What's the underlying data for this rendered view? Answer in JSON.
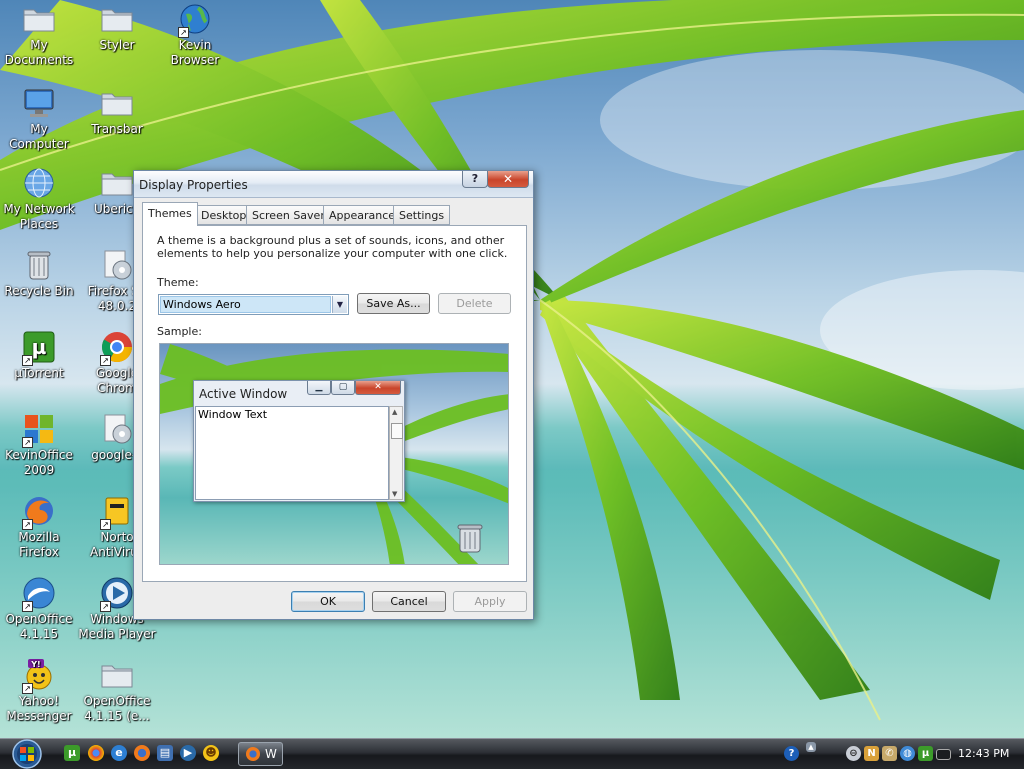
{
  "desktop_icons": [
    {
      "id": "my-documents",
      "label": "My\nDocuments",
      "icon": "folder-icon",
      "shortcut": false
    },
    {
      "id": "styler",
      "label": "Styler",
      "icon": "folder-icon",
      "shortcut": false
    },
    {
      "id": "kevin-browser",
      "label": "Kevin\nBrowser",
      "icon": "globe-icon",
      "shortcut": true
    },
    {
      "id": "my-computer",
      "label": "My Computer",
      "icon": "computer-icon",
      "shortcut": false
    },
    {
      "id": "transbar",
      "label": "Transbar",
      "icon": "folder-icon",
      "shortcut": false
    },
    {
      "id": "my-network-places",
      "label": "My Network\nPlaces",
      "icon": "network-globe-icon",
      "shortcut": false
    },
    {
      "id": "uberico",
      "label": "Uberico",
      "icon": "folder-icon",
      "shortcut": false
    },
    {
      "id": "recycle-bin",
      "label": "Recycle Bin",
      "icon": "recycle-bin-icon",
      "shortcut": false
    },
    {
      "id": "firefox-setup",
      "label": "Firefox Se\n48.0.2",
      "icon": "installer-icon",
      "shortcut": false
    },
    {
      "id": "utorrent",
      "label": "µTorrent",
      "icon": "utorrent-icon",
      "shortcut": true
    },
    {
      "id": "google-chrome",
      "label": "Google\nChrom",
      "icon": "chrome-icon",
      "shortcut": true
    },
    {
      "id": "kevinoffice-2009",
      "label": "KevinOffice\n2009",
      "icon": "office-icon",
      "shortcut": true
    },
    {
      "id": "google-c",
      "label": "google-c",
      "icon": "installer-icon",
      "shortcut": false
    },
    {
      "id": "mozilla-firefox",
      "label": "Mozilla\nFirefox",
      "icon": "firefox-icon",
      "shortcut": true
    },
    {
      "id": "norton-antivirus",
      "label": "Norto\nAntiVirus",
      "icon": "norton-icon",
      "shortcut": true
    },
    {
      "id": "openoffice",
      "label": "OpenOffice\n4.1.15",
      "icon": "openoffice-icon",
      "shortcut": true
    },
    {
      "id": "windows-media-player",
      "label": "Windows\nMedia Player",
      "icon": "media-player-icon",
      "shortcut": true
    },
    {
      "id": "yahoo-messenger",
      "label": "Yahoo!\nMessenger",
      "icon": "yahoo-icon",
      "shortcut": true
    },
    {
      "id": "openoffice-e",
      "label": "OpenOffice\n4.1.15 (e...",
      "icon": "folder-icon",
      "shortcut": false
    }
  ],
  "dialog": {
    "title": "Display Properties",
    "help_label": "?",
    "close_label": "✕",
    "tabs": [
      "Themes",
      "Desktop",
      "Screen Saver",
      "Appearance",
      "Settings"
    ],
    "active_tab": "Themes",
    "description": "A theme is a background plus a set of sounds, icons, and other elements to help you personalize your computer with one click.",
    "theme_label": "Theme:",
    "theme_value": "Windows Aero",
    "save_as_label": "Save As...",
    "delete_label": "Delete",
    "sample_label": "Sample:",
    "sample_window": {
      "title": "Active Window",
      "text": "Window Text"
    },
    "ok_label": "OK",
    "cancel_label": "Cancel",
    "apply_label": "Apply"
  },
  "taskbar": {
    "task_button_label": "W",
    "clock": "12:43 PM"
  }
}
